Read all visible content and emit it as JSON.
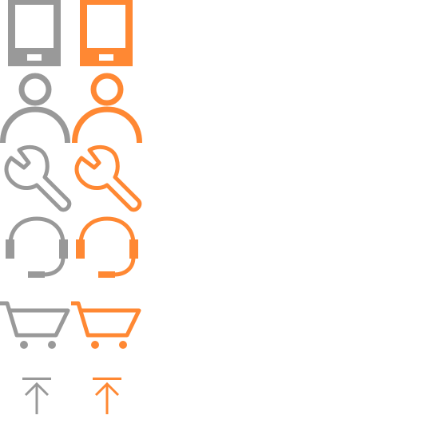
{
  "sprite_sheet": {
    "background_color": "#ffffff",
    "variants": {
      "default": {
        "state": "normal",
        "color": "#999999"
      },
      "active": {
        "state": "hover",
        "color": "#ff8833"
      }
    },
    "rows": [
      {
        "icon": "tablet-icon"
      },
      {
        "icon": "user-icon"
      },
      {
        "icon": "wrench-icon"
      },
      {
        "icon": "headset-icon"
      },
      {
        "icon": "shopping-cart-icon"
      },
      {
        "icon": "back-to-top-icon"
      }
    ]
  }
}
